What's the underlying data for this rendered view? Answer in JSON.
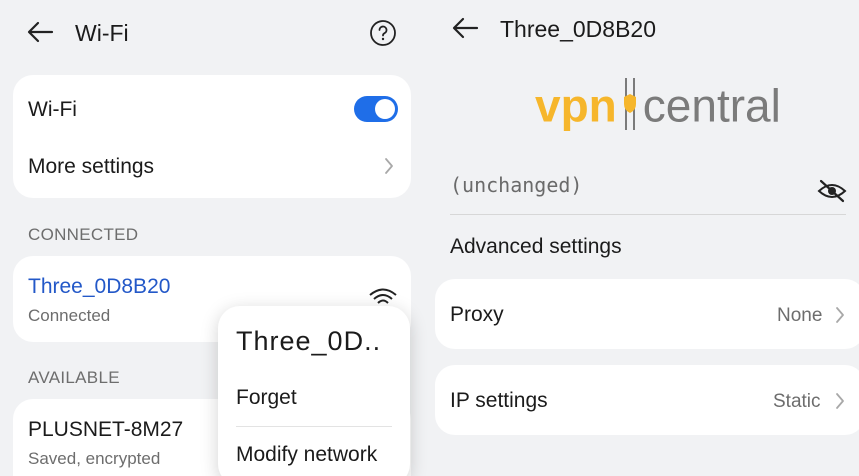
{
  "left": {
    "header": {
      "title": "Wi-Fi",
      "back_icon": "back-arrow-icon",
      "help_icon": "help-circle-icon"
    },
    "wifi_card": {
      "toggle_label": "Wi-Fi",
      "toggle_on": true,
      "more_settings_label": "More settings"
    },
    "connected_section": {
      "label": "CONNECTED",
      "network": {
        "name": "Three_0D8B20",
        "status": "Connected",
        "signal_icon": "wifi-lock-icon"
      }
    },
    "available_section": {
      "label": "AVAILABLE",
      "networks": [
        {
          "name": "PLUSNET-8M27",
          "status": "Saved, encrypted"
        }
      ]
    },
    "popup_menu": {
      "title": "Three_0D..",
      "items": [
        "Forget",
        "Modify network"
      ]
    }
  },
  "right": {
    "header": {
      "title": "Three_0D8B20",
      "back_icon": "back-arrow-icon"
    },
    "watermark": {
      "part1": "vpn",
      "part2": "central"
    },
    "password_field": {
      "value": "(unchanged)",
      "visibility_icon": "eye-off-icon"
    },
    "advanced_label": "Advanced settings",
    "proxy": {
      "label": "Proxy",
      "value": "None"
    },
    "ip_settings": {
      "label": "IP settings",
      "value": "Static"
    }
  },
  "colors": {
    "accent": "#1f6ee8",
    "link_blue": "#2358c8",
    "logo_orange": "#f6b62b",
    "background": "#f1f2f4"
  }
}
